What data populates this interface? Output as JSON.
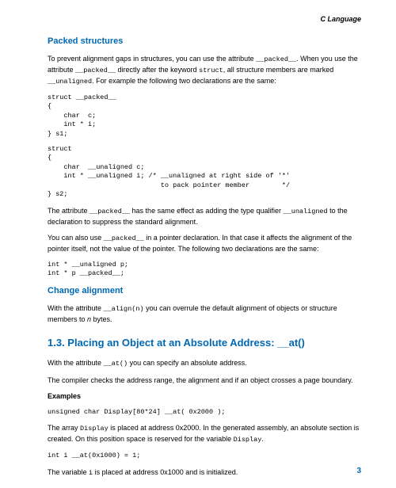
{
  "header": {
    "title": "C Language"
  },
  "sec1": {
    "heading": "Packed structures",
    "p1_a": "To prevent alignment gaps in structures, you can use the attribute ",
    "p1_code1": "__packed__",
    "p1_b": ". When you use the attribute ",
    "p1_code2": "__packed__",
    "p1_c": " directly after the keyword ",
    "p1_code3": "struct",
    "p1_d": ", all structure members are marked ",
    "p1_code4": "__unaligned",
    "p1_e": ". For example the following two declarations are the same:",
    "code1": "struct __packed__\n{\n    char  c;\n    int * i;\n} s1;",
    "code2": "struct\n{\n    char  __unaligned c;\n    int * __unaligned i; /* __unaligned at right side of '*'\n                            to pack pointer member        */\n} s2;",
    "p2_a": "The attribute ",
    "p2_code1": "__packed__",
    "p2_b": " has the same effect as adding the type qualifier ",
    "p2_code2": "__unaligned",
    "p2_c": " to the declaration to suppress the standard alignment.",
    "p3_a": "You can also use ",
    "p3_code1": "__packed__",
    "p3_b": " in a pointer declaration. In that case it affects the alignment of the pointer itself, not the value of the pointer. The following two declarations are the same:",
    "code3": "int * __unaligned p;\nint * p __packed__;"
  },
  "sec2": {
    "heading": "Change alignment",
    "p1_a": "With the attribute ",
    "p1_code1": "__align(n)",
    "p1_b": " you can overrule the default alignment of objects or structure members to ",
    "p1_i": "n",
    "p1_c": " bytes."
  },
  "sec3": {
    "heading": "1.3. Placing an Object at an Absolute Address: __at()",
    "p1_a": "With the attribute ",
    "p1_code1": "__at()",
    "p1_b": " you can specify an absolute address.",
    "p2": "The compiler checks the address range, the alignment and if an object crosses a page boundary.",
    "ex": "Examples",
    "code1": "unsigned char Display[80*24] __at( 0x2000 );",
    "p3_a": "The array ",
    "p3_code1": "Display",
    "p3_b": " is placed at address 0x2000. In the generated assembly, an absolute section is created. On this position space is reserved for the variable ",
    "p3_code2": "Display",
    "p3_c": ".",
    "code2": "int i __at(0x1000) = 1;",
    "p4_a": "The variable ",
    "p4_code1": "i",
    "p4_b": " is placed at address 0x1000 and is initialized."
  },
  "page": "3"
}
